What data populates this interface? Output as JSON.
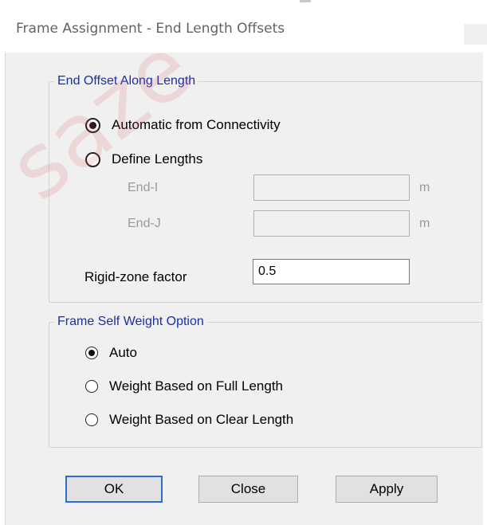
{
  "window": {
    "title": "Frame Assignment - End Length Offsets"
  },
  "watermark": {
    "text": "saze"
  },
  "end_offset": {
    "group_title": "End Offset Along Length",
    "automatic_label": "Automatic from Connectivity",
    "define_label": "Define Lengths",
    "selected": "automatic",
    "end_i_label": "End-I",
    "end_i_value": "",
    "end_i_unit": "m",
    "end_j_label": "End-J",
    "end_j_value": "",
    "end_j_unit": "m",
    "rigid_label": "Rigid-zone factor",
    "rigid_value": "0.5"
  },
  "self_weight": {
    "group_title": "Frame Self Weight Option",
    "auto_label": "Auto",
    "full_label": "Weight Based on Full Length",
    "clear_label": "Weight Based on Clear Length",
    "selected": "auto"
  },
  "buttons": {
    "ok": "OK",
    "close": "Close",
    "apply": "Apply"
  },
  "colors": {
    "group_title": "#1a2ea8",
    "dialog_bg": "#f0f0f0",
    "default_button_border": "#2b6fd6"
  }
}
